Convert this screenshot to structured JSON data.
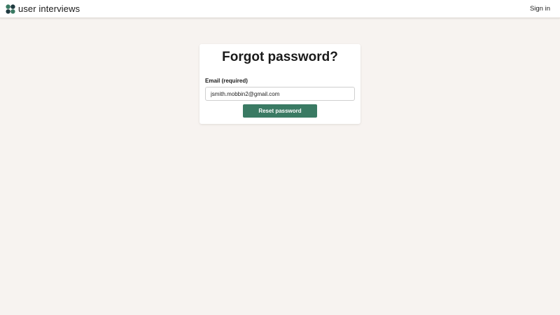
{
  "header": {
    "brand": "user interviews",
    "signin_label": "Sign in"
  },
  "form": {
    "title": "Forgot password?",
    "email_label": "Email (required)",
    "email_value": "jsmith.mobbin2@gmail.com",
    "submit_label": "Reset password"
  },
  "colors": {
    "background": "#f7f3f0",
    "accent": "#3a7a63",
    "logo_green": "#3a7a63",
    "logo_dark": "#1f3a40"
  }
}
